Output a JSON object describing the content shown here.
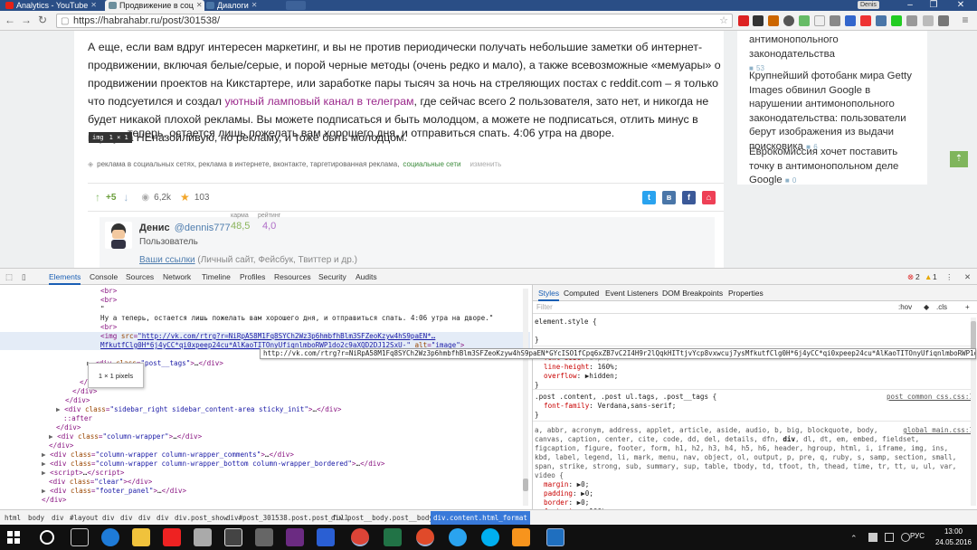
{
  "browser": {
    "tabs": [
      {
        "label": "Analytics - YouTube",
        "icon": "youtube-icon",
        "color": "#e62117"
      },
      {
        "label": "Продвижение в соц",
        "icon": "habr-icon",
        "color": "#6d8f9d"
      },
      {
        "label": "Диалоги",
        "icon": "vk-icon",
        "color": "#4a76a8"
      }
    ],
    "url": "https://habrahabr.ru/post/301538/",
    "window_badge": "Denis"
  },
  "article": {
    "paragraph1": "А еще, если вам вдруг интересен маркетинг, и вы не против периодически получать небольшие заметки об интернет-продвижении, включая белые/серые, и порой черные методы (очень редко и мало), а также всевозможные «мемуары» о продвижении проектов на Кикстартере, или заработке пары тысяч за ночь на стреляющих постах с reddit.com – я только что подсуетился и создал",
    "paragraph1_link": "уютный ламповый канал в телеграм",
    "paragraph1_end": ", где сейчас всего 2 пользователя, зато нет, и никогда не будет никакой плохой рекламы. Вы можете подписаться и быть молодцом, а можете не подписаться, отлить минус в карму за НЕназойливую, но рекламу, и тоже быть молодцом.",
    "paragraph2": "теперь, остается лишь пожелать вам хорошего дня, и отправиться спать. 4:06 утра на дворе.",
    "img_tooltip": {
      "tag": "img",
      "size": "1 × 1"
    },
    "tags": "реклама в социальных сетях, реклама в интернете, вконтакте, таргетированная реклама,",
    "tag_hub": "социальные сети",
    "tag_edit": "изменить",
    "votes": "+5",
    "views": "6,2k",
    "favorites": "103",
    "author": {
      "name": "Денис",
      "handle": "@dennis777",
      "role": "Пользователь",
      "karma_label": "карма",
      "karma": "48,5",
      "rating_label": "рейтинг",
      "rating": "4,0",
      "links_label": "Ваши ссылки",
      "links_hint": "(Личный сайт, Фейсбук, Твиттер и др.)"
    }
  },
  "sidebar": {
    "items": [
      {
        "title": "антимонопольного законодательства",
        "count": "53"
      },
      {
        "title": "Крупнейший фотобанк мира Getty Images обвинил Google в нарушении антимонопольного законодательства: пользователи берут изображения из выдачи поисковика",
        "count": "6"
      },
      {
        "title": "Еврокомиссия хочет поставить точку в антимонопольном деле Google",
        "count": "0"
      }
    ]
  },
  "devtools": {
    "tabs": [
      "Elements",
      "Console",
      "Sources",
      "Network",
      "Timeline",
      "Profiles",
      "Resources",
      "Security",
      "Audits"
    ],
    "errors": "2",
    "warnings": "1",
    "style_tabs": [
      "Styles",
      "Computed",
      "Event Listeners",
      "DOM Breakpoints",
      "Properties"
    ],
    "filter_placeholder": "Filter",
    "hov": ":hov",
    "cls": ".cls",
    "url_tooltip": "http://vk.com/rtrg?r=NiRpA58M1Fq8SYCh2Wz3p6hmbfhBlm3SFZeoKzyw4hS9paEN*GYcISO1fCpq6xZB7vC2I4H9r2lQqkHITtjvYcp8vxwcuj7ysMfkutfClg0H*6j4yCC*qi0xpeep24cu*AlKaoTITOnyUfiqnlmboRWP1do2c9aXQD2DJ12SxU-",
    "pixel_tooltip": "1 × 1 pixels",
    "breadcrumbs": [
      "html",
      "body",
      "div",
      "#layout",
      "div",
      "div",
      "div",
      "div",
      "div.post_show",
      "div#post_301538.post.post_full",
      "div.post__body.post__body_full",
      "div.content.html_format"
    ]
  },
  "taskbar": {
    "lang": "РУС",
    "time": "13:00",
    "date": "24.05.2016"
  }
}
